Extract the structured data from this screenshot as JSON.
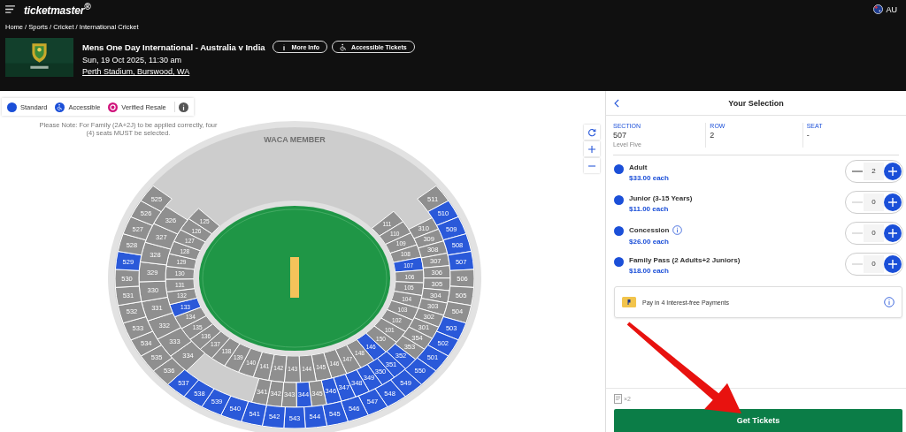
{
  "header": {
    "logo": "ticketmaster$^{®}$",
    "region": "AU"
  },
  "breadcrumb": "Home / Sports / Cricket / International Cricket",
  "event": {
    "title": "Mens One Day International - Australia v India",
    "date": "Sun, 19 Oct 2025, 11:30 am",
    "venue": "Perth Stadium, Burswood, WA",
    "buttons": [
      {
        "label": "More Info",
        "kind": "info"
      },
      {
        "label": "Accessible Tickets",
        "kind": "accessible"
      }
    ]
  },
  "map": {
    "legend": [
      {
        "label": "Standard",
        "kind": "standard",
        "color": "#1b4fd8"
      },
      {
        "label": "Accessible",
        "kind": "accessible",
        "color": "#1b4fd8"
      },
      {
        "label": "Verified Resale",
        "kind": "resale",
        "color": "#d0147c"
      }
    ],
    "note": "Please Note: For Family (2A+2J) to be applied correctly, four (4) seats MUST be selected.",
    "member_area": "WACA MEMBER",
    "rings": [
      {
        "left": [
          {
            "label": "125",
            "available": false
          },
          {
            "label": "126",
            "available": false
          },
          {
            "label": "127",
            "available": false
          },
          {
            "label": "128",
            "available": false
          },
          {
            "label": "129",
            "available": false
          },
          {
            "label": "130",
            "available": false
          },
          {
            "label": "131",
            "available": false
          },
          {
            "label": "132",
            "available": false
          },
          {
            "label": "133",
            "available": true
          },
          {
            "label": "134",
            "available": false
          },
          {
            "label": "135",
            "available": false
          },
          {
            "label": "136",
            "available": false
          },
          {
            "label": "137",
            "available": false
          },
          {
            "label": "138",
            "available": false
          },
          {
            "label": "139",
            "available": false
          },
          {
            "label": "140",
            "available": false
          },
          {
            "label": "141",
            "available": false
          },
          {
            "label": "142",
            "available": false
          },
          {
            "label": "143",
            "available": false
          }
        ],
        "right": [
          {
            "label": "111",
            "available": false
          },
          {
            "label": "110",
            "available": false
          },
          {
            "label": "109",
            "available": false
          },
          {
            "label": "108",
            "available": false
          },
          {
            "label": "107",
            "available": true
          },
          {
            "label": "106",
            "available": false
          },
          {
            "label": "105",
            "available": false
          },
          {
            "label": "104",
            "available": false
          },
          {
            "label": "103",
            "available": false
          },
          {
            "label": "102",
            "available": false
          },
          {
            "label": "101",
            "available": false
          },
          {
            "label": "150",
            "available": false
          },
          {
            "label": "146",
            "available": true
          },
          {
            "label": "148",
            "available": false
          },
          {
            "label": "147",
            "available": false
          },
          {
            "label": "146",
            "available": false
          },
          {
            "label": "145",
            "available": false
          },
          {
            "label": "144",
            "available": false
          }
        ]
      },
      {
        "left": [
          {
            "label": "326",
            "available": false
          },
          {
            "label": "327",
            "available": false
          },
          {
            "label": "328",
            "available": false
          },
          {
            "label": "329",
            "available": false
          },
          {
            "label": "330",
            "available": false
          },
          {
            "label": "331",
            "available": false
          },
          {
            "label": "332",
            "available": false
          },
          {
            "label": "333",
            "available": false
          },
          {
            "label": "334",
            "available": false
          },
          {
            "label": "341",
            "available": false
          },
          {
            "label": "342",
            "available": false
          },
          {
            "label": "343",
            "available": false
          },
          {
            "label": "344",
            "available": true
          }
        ],
        "right": [
          {
            "label": "310",
            "available": false
          },
          {
            "label": "309",
            "available": false
          },
          {
            "label": "308",
            "available": false
          },
          {
            "label": "307",
            "available": false
          },
          {
            "label": "306",
            "available": false
          },
          {
            "label": "305",
            "available": false
          },
          {
            "label": "304",
            "available": false
          },
          {
            "label": "303",
            "available": false
          },
          {
            "label": "302",
            "available": false
          },
          {
            "label": "301",
            "available": false
          },
          {
            "label": "354",
            "available": false
          },
          {
            "label": "353",
            "available": false
          },
          {
            "label": "352",
            "available": true
          },
          {
            "label": "351",
            "available": true
          },
          {
            "label": "350",
            "available": true
          },
          {
            "label": "349",
            "available": true
          },
          {
            "label": "348",
            "available": true
          },
          {
            "label": "347",
            "available": true
          },
          {
            "label": "346",
            "available": true
          },
          {
            "label": "345",
            "available": false
          }
        ]
      },
      {
        "left": [
          {
            "label": "525",
            "available": false
          },
          {
            "label": "526",
            "available": false
          },
          {
            "label": "527",
            "available": false
          },
          {
            "label": "528",
            "available": false
          },
          {
            "label": "529",
            "available": true
          },
          {
            "label": "530",
            "available": false
          },
          {
            "label": "531",
            "available": false
          },
          {
            "label": "532",
            "available": false
          },
          {
            "label": "533",
            "available": false
          },
          {
            "label": "534",
            "available": false
          },
          {
            "label": "535",
            "available": false
          },
          {
            "label": "536",
            "available": false
          },
          {
            "label": "537",
            "available": true
          },
          {
            "label": "538",
            "available": true
          },
          {
            "label": "539",
            "available": true
          },
          {
            "label": "540",
            "available": true
          },
          {
            "label": "541",
            "available": true
          },
          {
            "label": "542",
            "available": true
          },
          {
            "label": "543",
            "available": true
          }
        ],
        "right": [
          {
            "label": "511",
            "available": false
          },
          {
            "label": "510",
            "available": true
          },
          {
            "label": "509",
            "available": true
          },
          {
            "label": "508",
            "available": true
          },
          {
            "label": "507",
            "available": true
          },
          {
            "label": "506",
            "available": false
          },
          {
            "label": "505",
            "available": false
          },
          {
            "label": "504",
            "available": false
          },
          {
            "label": "503",
            "available": true
          },
          {
            "label": "502",
            "available": true
          },
          {
            "label": "501",
            "available": true
          },
          {
            "label": "550",
            "available": true
          },
          {
            "label": "549",
            "available": true
          },
          {
            "label": "548",
            "available": true
          },
          {
            "label": "547",
            "available": true
          },
          {
            "label": "546",
            "available": true
          },
          {
            "label": "545",
            "available": true
          },
          {
            "label": "544",
            "available": true
          }
        ]
      }
    ]
  },
  "selection": {
    "title": "Your Selection",
    "fields": [
      {
        "label": "SECTION",
        "value": "507",
        "note": "Level Five"
      },
      {
        "label": "ROW",
        "value": "2"
      },
      {
        "label": "SEAT",
        "value": "-"
      }
    ],
    "tickets": [
      {
        "name": "Adult",
        "price": "$33.00 each",
        "quantity": "2",
        "can_decrease": true,
        "info": false
      },
      {
        "name": "Junior (3-15 Years)",
        "price": "$11.00 each",
        "quantity": "0",
        "can_decrease": false,
        "info": false
      },
      {
        "name": "Concession",
        "price": "$26.00 each",
        "quantity": "0",
        "can_decrease": false,
        "info": true
      },
      {
        "name": "Family Pass (2 Adults+2 Juniors)",
        "price": "$18.00 each",
        "quantity": "0",
        "can_decrease": false,
        "info": false
      }
    ],
    "payment_offer": "Pay in 4 Interest-free Payments",
    "ticket_count": "×2",
    "action": "Get Tickets"
  }
}
